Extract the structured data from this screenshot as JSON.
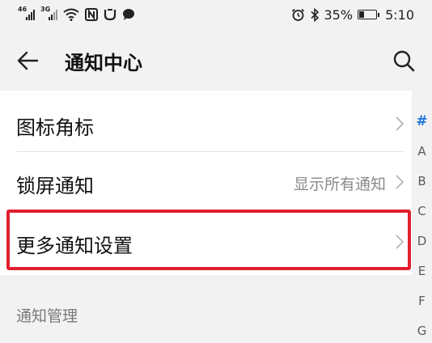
{
  "status_bar": {
    "signal1_label": "46",
    "signal2_label": "3G",
    "nfc_icon": "nfc-icon",
    "battery_percent": "35%",
    "battery_level": 0.35,
    "time": "5:10"
  },
  "header": {
    "title": "通知中心",
    "back_icon": "arrow-left-icon",
    "search_icon": "search-icon"
  },
  "list": {
    "items": [
      {
        "label": "图标角标",
        "value": ""
      },
      {
        "label": "锁屏通知",
        "value": "显示所有通知"
      },
      {
        "label": "更多通知设置",
        "value": ""
      }
    ],
    "highlight_color": "#e0202e"
  },
  "section": {
    "label": "通知管理"
  },
  "index": {
    "letters": [
      "#",
      "A",
      "B",
      "C",
      "D",
      "E",
      "F",
      "G"
    ],
    "active": "#",
    "active_color": "#1a73d8"
  }
}
